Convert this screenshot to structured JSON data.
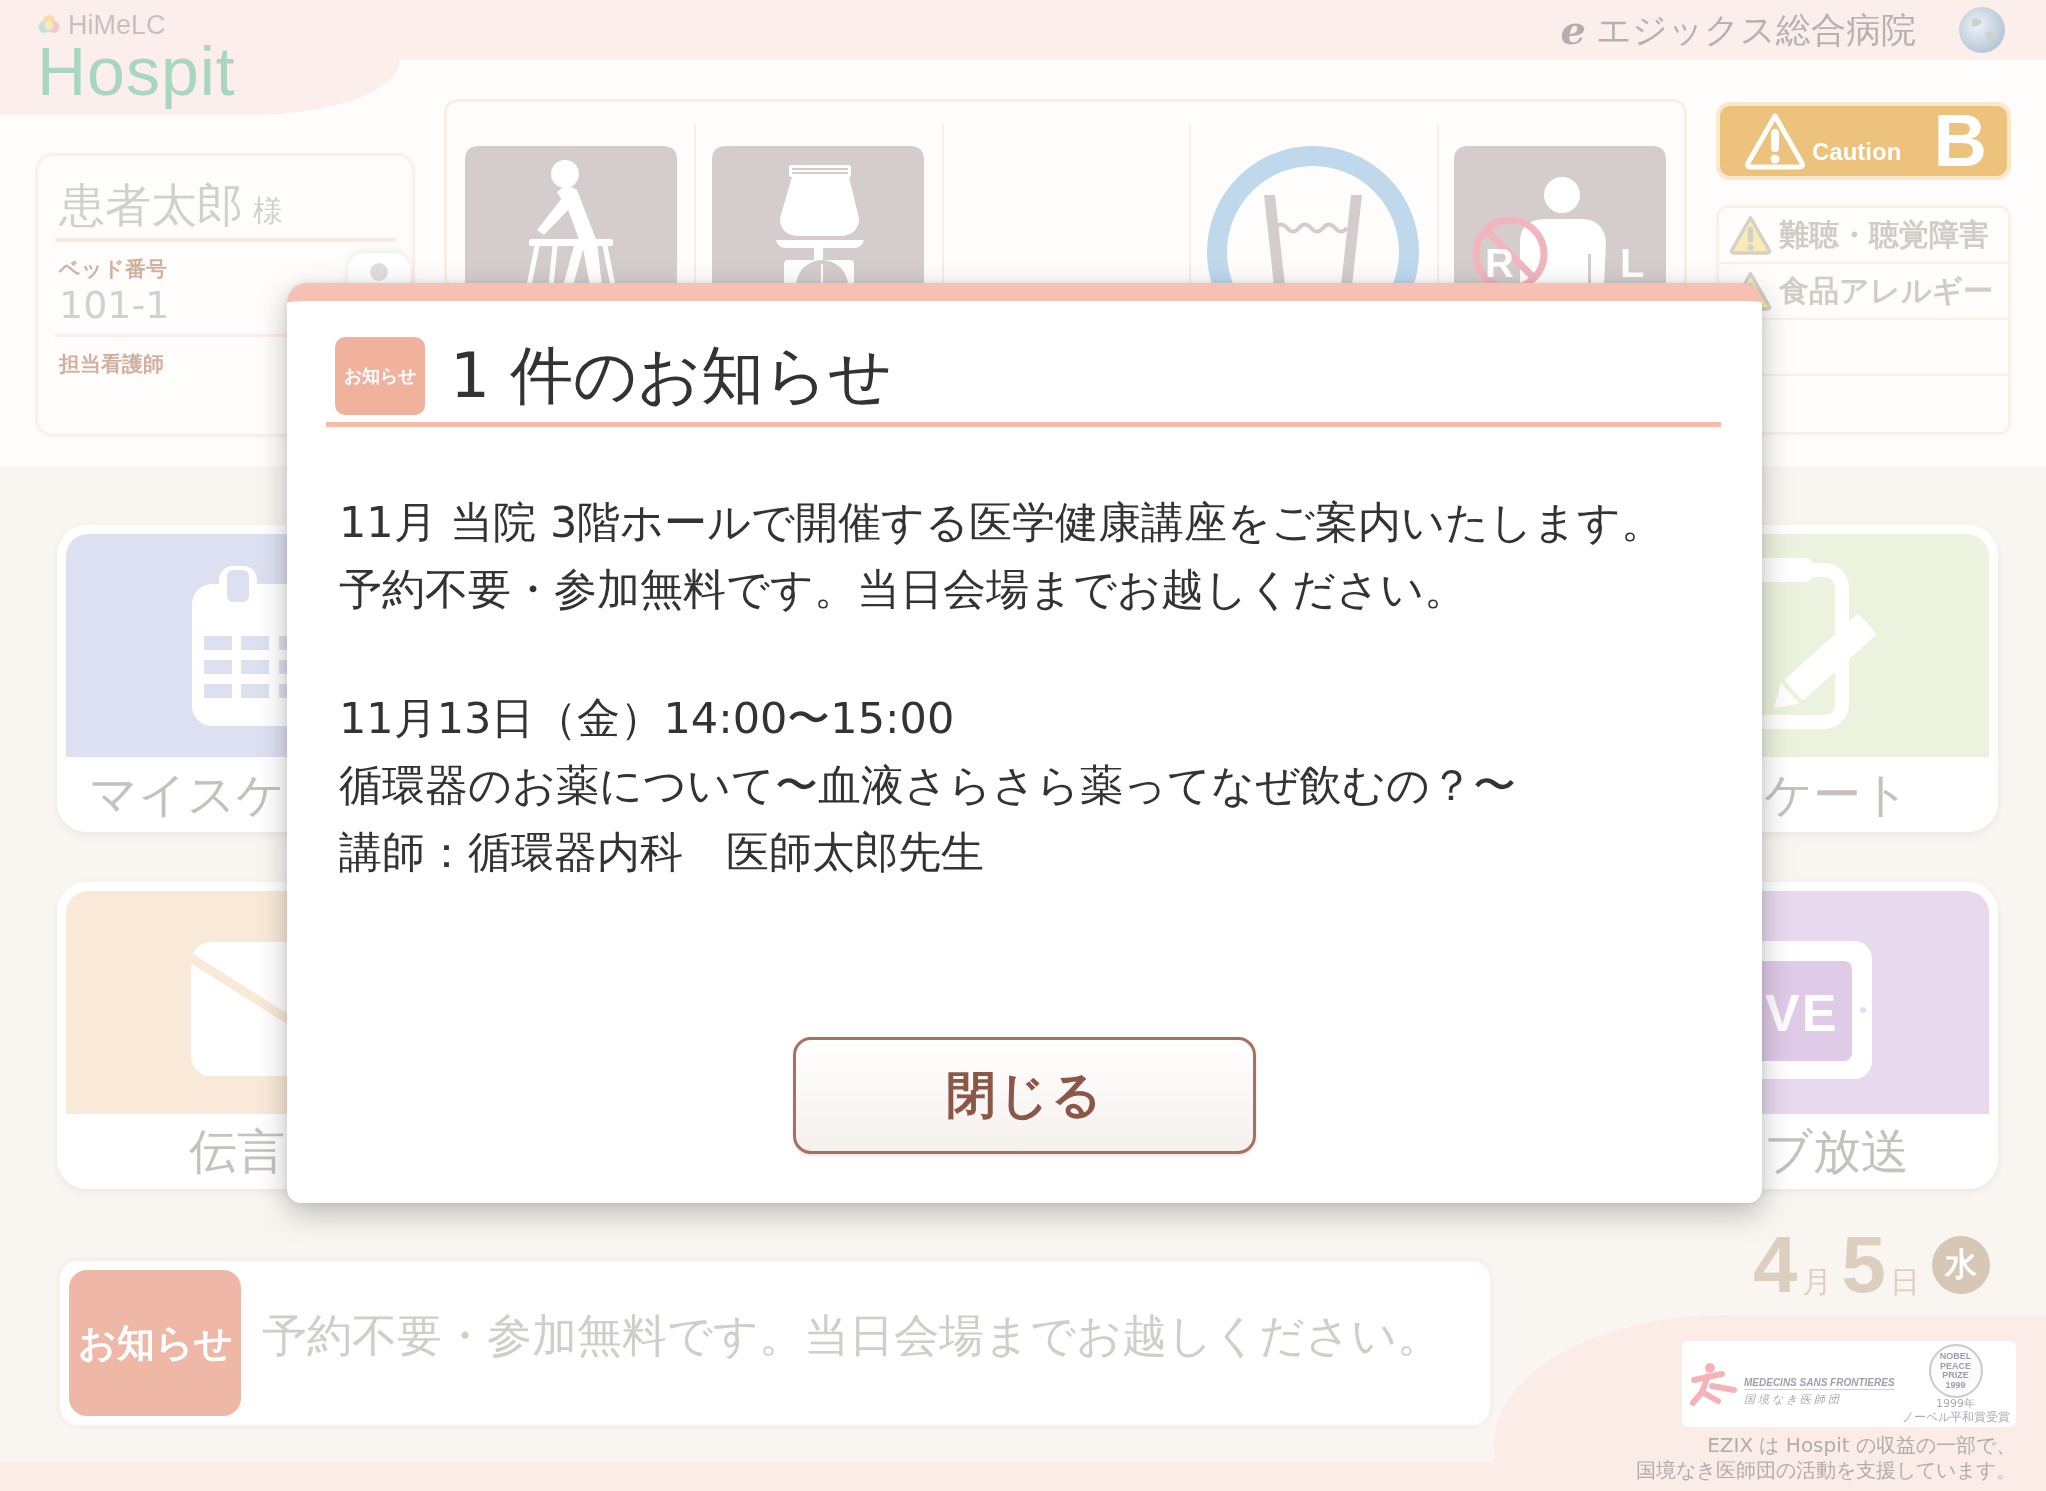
{
  "header": {
    "logo_small": "HiMeLC",
    "logo_large": "Hospit",
    "brand_mark": "e",
    "hospital_name": "エジックス総合病院"
  },
  "patient": {
    "name": "患者太郎",
    "honorific": "様",
    "bed_label": "ベッド番号",
    "bed_number": "101-1",
    "nurse_label": "担当看護師"
  },
  "care_icons": [
    {
      "kind": "walker"
    },
    {
      "kind": "commode"
    },
    {
      "kind": "none"
    },
    {
      "kind": "water"
    },
    {
      "kind": "arm",
      "letters": [
        {
          "text": "R",
          "restricted": true
        },
        {
          "text": "L",
          "restricted": false
        }
      ]
    }
  ],
  "caution": {
    "label": "Caution",
    "grade": "B"
  },
  "alerts": [
    {
      "text": "難聴・聴覚障害"
    },
    {
      "text": "食品アレルギー"
    }
  ],
  "tile_rows": [
    {
      "tiles": [
        {
          "kind": "calendar",
          "label": "マイスケ",
          "color": "#dde0f1"
        },
        {
          "kind": "clipboard",
          "label": "ケート",
          "color": "#ebf2dd"
        }
      ]
    },
    {
      "tiles": [
        {
          "kind": "envelope",
          "label": "伝言",
          "color": "#f9e9d8"
        },
        {
          "kind": "tablet",
          "label": "ブ放送",
          "color": "#e8d9ef",
          "icon_text": "VE"
        }
      ]
    }
  ],
  "ticker": {
    "badge": "お知らせ",
    "text": "予約不要・参加無料です。当日会場までお越しください。"
  },
  "date": {
    "month": "4",
    "month_unit": "月",
    "day": "5",
    "day_unit": "日",
    "weekday": "水"
  },
  "sponsor": {
    "name_en": "MEDECINS SANS FRONTIERES",
    "name_ja": "国境なき医師団",
    "seal_text": "NOBEL PEACE PRIZE 1999",
    "prize_year": "1999年",
    "prize_caption": "ノーベル平和賞受賞",
    "note_lines": [
      "EZIX は Hospit の収益の一部で、",
      "国境なき医師団の活動を支援しています。"
    ]
  },
  "dialog": {
    "badge": "お知らせ",
    "title": "1 件のお知らせ",
    "paragraphs": [
      {
        "lines": [
          "11月 当院 3階ホールで開催する医学健康講座をご案内いたします。",
          "予約不要・参加無料です。当日会場までお越しください。"
        ]
      },
      {
        "lines": [
          "11月13日（金）14:00〜15:00",
          "循環器のお薬について〜血液さらさら薬ってなぜ飲むの？〜",
          "講師：循環器内科　医師太郎先生"
        ]
      }
    ],
    "close_button": "閉じる"
  }
}
